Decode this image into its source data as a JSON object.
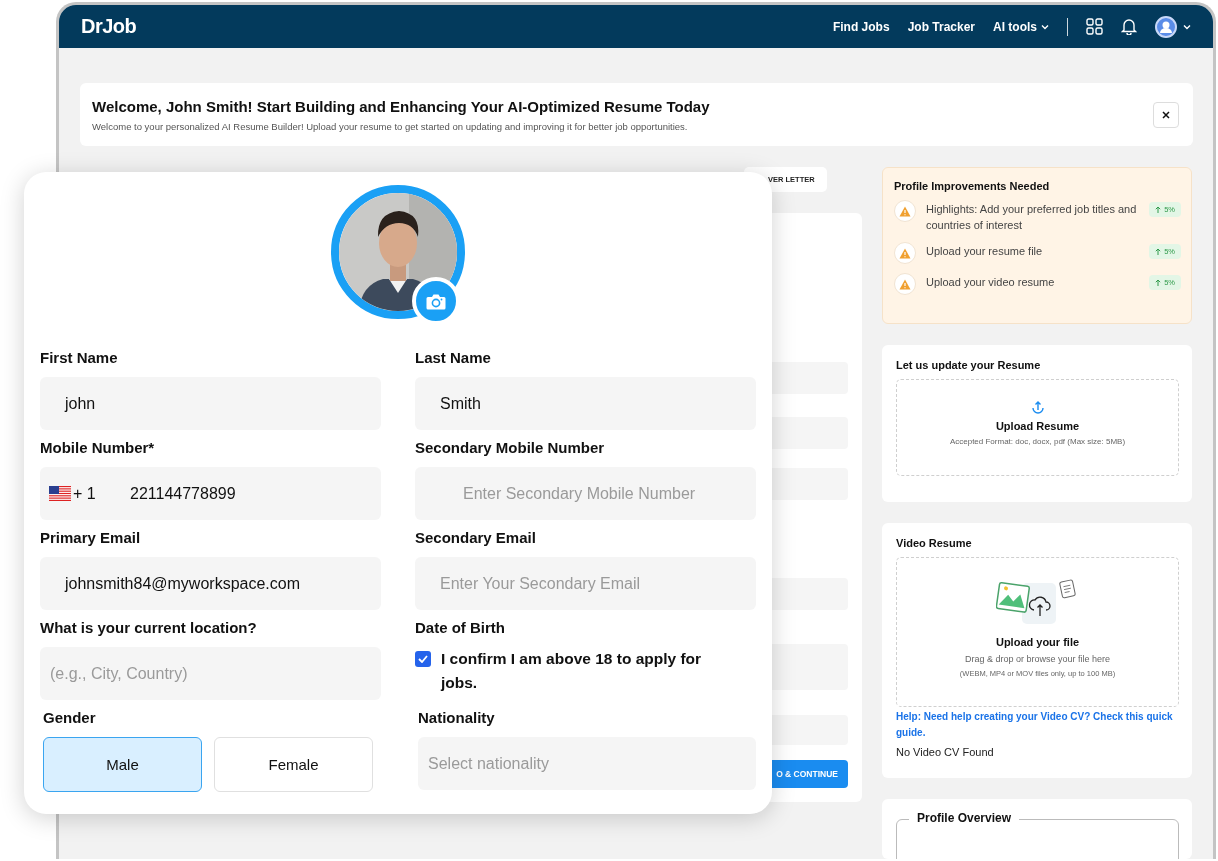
{
  "header": {
    "logo": "DrJob",
    "nav": [
      {
        "label": "Find Jobs",
        "kind": "link"
      },
      {
        "label": "Job Tracker",
        "kind": "link"
      },
      {
        "label": "AI tools",
        "kind": "menu"
      }
    ]
  },
  "welcome_banner": {
    "title": "Welcome, John Smith! Start Building and Enhancing Your AI-Optimized Resume Today",
    "message": "Welcome to your personalized AI Resume Builder! Upload your resume to get started on updating and improving it for better job opportunities."
  },
  "builder_tab": {
    "label": "VER LETTER"
  },
  "continue_button": {
    "label": "O & CONTINUE"
  },
  "improvements": {
    "title": "Profile Improvements Needed",
    "items": [
      {
        "text": "Highlights: Add your preferred job titles and countries of interest",
        "gain": "5%"
      },
      {
        "text": "Upload your resume file",
        "gain": "5%"
      },
      {
        "text": "Upload your video resume",
        "gain": "5%"
      }
    ]
  },
  "resume_upload": {
    "title": "Let us update your Resume",
    "action": "Upload Resume",
    "hint": "Accepted Format: doc, docx, pdf (Max size: 5MB)"
  },
  "video_resume": {
    "title": "Video Resume",
    "action": "Upload your file",
    "hint": "Drag & drop or browse your file here",
    "formats": "(WEBM, MP4 or MOV files only, up to 100 MB)",
    "help_link": "Help: Need help creating your Video CV? Check this quick guide.",
    "status": "No Video CV Found"
  },
  "profile_overview": {
    "title": "Profile Overview"
  },
  "profile_form": {
    "fields": [
      {
        "kind": "text",
        "label": "First Name",
        "value": "john"
      },
      {
        "kind": "text",
        "label": "Last Name",
        "value": "Smith"
      },
      {
        "kind": "phone",
        "label": "Mobile Number*",
        "country_code": "+ 1",
        "value": "221144778899"
      },
      {
        "kind": "text",
        "label": "Secondary Mobile Number",
        "placeholder": "Enter Secondary Mobile Number"
      },
      {
        "kind": "text",
        "label": "Primary Email",
        "value": "johnsmith84@myworkspace.com"
      },
      {
        "kind": "text",
        "label": "Secondary Email",
        "placeholder": "Enter Your Secondary Email"
      },
      {
        "kind": "text",
        "label": "What is your current location?",
        "placeholder": "(e.g., City, Country)"
      },
      {
        "kind": "checkbox",
        "label": "Date of Birth",
        "text": "I confirm I am above 18 to apply for jobs.",
        "checked": true
      },
      {
        "kind": "choice",
        "label": "Gender",
        "options": [
          {
            "label": "Male",
            "selected": true
          },
          {
            "label": "Female",
            "selected": false
          }
        ]
      },
      {
        "kind": "select",
        "label": "Nationality",
        "placeholder": "Select nationality"
      }
    ]
  }
}
